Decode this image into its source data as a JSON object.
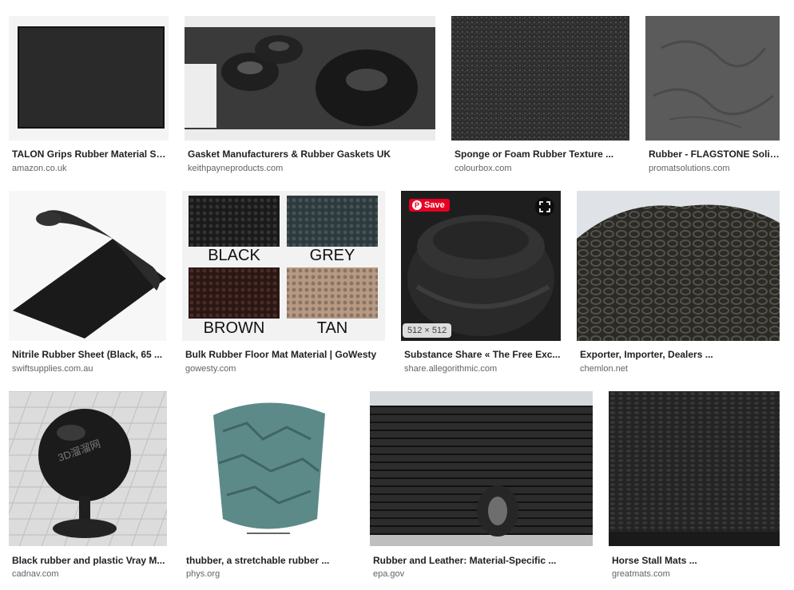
{
  "results": [
    {
      "title": "TALON Grips Rubber Material Sh...",
      "source": "amazon.co.uk"
    },
    {
      "title": "Gasket Manufacturers & Rubber Gaskets UK",
      "source": "keithpayneproducts.com"
    },
    {
      "title": "Sponge or Foam Rubber Texture ...",
      "source": "colourbox.com"
    },
    {
      "title": "Rubber - FLAGSTONE Solid...",
      "source": "promatsolutions.com"
    },
    {
      "title": "Nitrile Rubber Sheet (Black, 65 ...",
      "source": "swiftsupplies.com.au"
    },
    {
      "title": "Bulk Rubber Floor Mat Material | GoWesty",
      "source": "gowesty.com",
      "labels": [
        "BLACK",
        "GREY",
        "BROWN",
        "TAN"
      ]
    },
    {
      "title": "Substance Share « The Free Exc...",
      "source": "share.allegorithmic.com",
      "save_label": "Save",
      "dimensions": "512 × 512"
    },
    {
      "title": "Exporter, Importer, Dealers ...",
      "source": "chemlon.net"
    },
    {
      "title": "Black rubber and plastic Vray M...",
      "source": "cadnav.com",
      "watermark": "3D溜溜网"
    },
    {
      "title": "thubber, a stretchable rubber ...",
      "source": "phys.org"
    },
    {
      "title": "Rubber and Leather: Material-Specific ...",
      "source": "epa.gov"
    },
    {
      "title": "Horse Stall Mats ...",
      "source": "greatmats.com"
    }
  ]
}
